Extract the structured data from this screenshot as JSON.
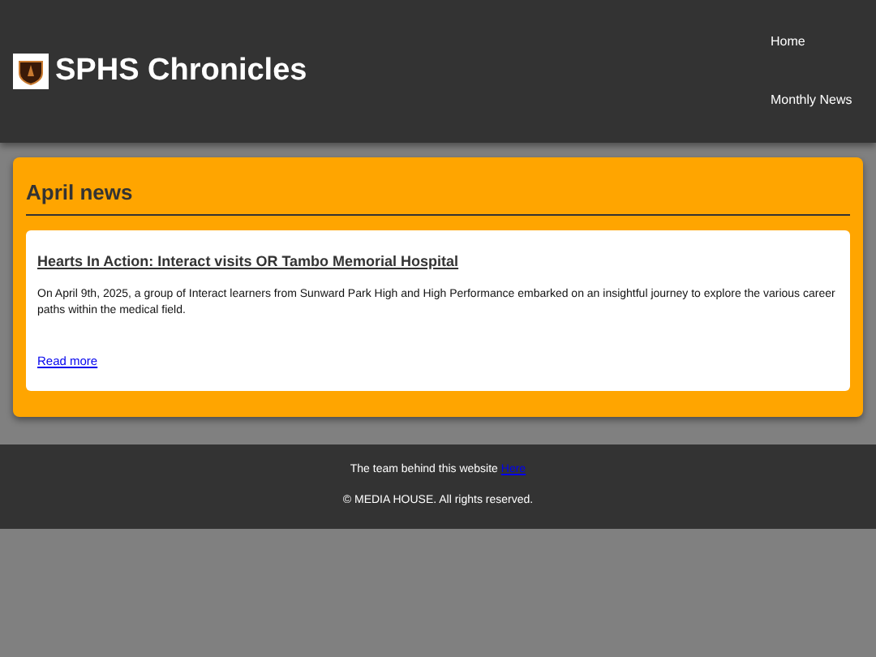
{
  "header": {
    "title": "SPHS Chronicles",
    "nav": [
      {
        "label": "Home"
      },
      {
        "label": "Monthly News"
      }
    ]
  },
  "section": {
    "heading": "April news",
    "articles": [
      {
        "title": "Hearts In Action: Interact visits OR Tambo Memorial Hospital",
        "summary": "On April 9th, 2025, a group of Interact learners from Sunward Park High and High Performance embarked on an insightful journey to explore the various career paths within the medical field.",
        "link": "Read more"
      }
    ]
  },
  "footer": {
    "team_text": "The team behind this website",
    "team_link": "Here",
    "copyright": "© MEDIA HOUSE. All rights reserved."
  }
}
